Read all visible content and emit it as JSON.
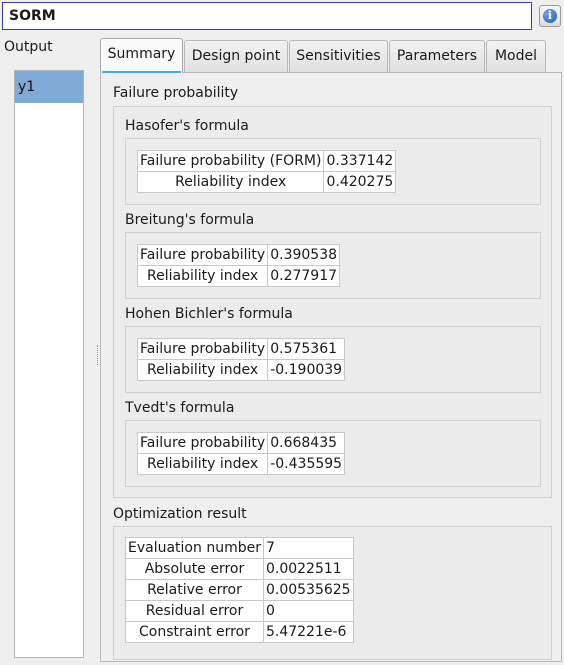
{
  "window": {
    "title": "SORM"
  },
  "info_icon": "info-icon",
  "output": {
    "label": "Output",
    "items": [
      "y1"
    ]
  },
  "tabs": [
    {
      "label": "Summary",
      "active": true
    },
    {
      "label": "Design point",
      "active": false
    },
    {
      "label": "Sensitivities",
      "active": false
    },
    {
      "label": "Parameters",
      "active": false
    },
    {
      "label": "Model",
      "active": false
    }
  ],
  "summary": {
    "failure_probability_title": "Failure probability",
    "hasofer": {
      "title": "Hasofer's formula",
      "rows": [
        {
          "key": "Failure probability (FORM)",
          "value": "0.337142"
        },
        {
          "key": "Reliability index",
          "value": "0.420275"
        }
      ]
    },
    "breitung": {
      "title": "Breitung's formula",
      "rows": [
        {
          "key": "Failure probability",
          "value": "0.390538"
        },
        {
          "key": "Reliability index",
          "value": "0.277917"
        }
      ]
    },
    "hohen": {
      "title": "Hohen Bichler's formula",
      "rows": [
        {
          "key": "Failure probability",
          "value": "0.575361"
        },
        {
          "key": "Reliability index",
          "value": "-0.190039"
        }
      ]
    },
    "tvedt": {
      "title": "Tvedt's formula",
      "rows": [
        {
          "key": "Failure probability",
          "value": "0.668435"
        },
        {
          "key": "Reliability index",
          "value": "-0.435595"
        }
      ]
    },
    "optimization": {
      "title": "Optimization result",
      "rows": [
        {
          "key": "Evaluation number",
          "value": "7"
        },
        {
          "key": "Absolute error",
          "value": "0.0022511"
        },
        {
          "key": "Relative error",
          "value": "0.00535625"
        },
        {
          "key": "Residual error",
          "value": "0"
        },
        {
          "key": "Constraint error",
          "value": "5.47221e-6"
        }
      ]
    }
  },
  "colors": {
    "selection": "#7fa9d6",
    "tab_accent": "#3daee9",
    "title_border": "#3a3ab0"
  }
}
